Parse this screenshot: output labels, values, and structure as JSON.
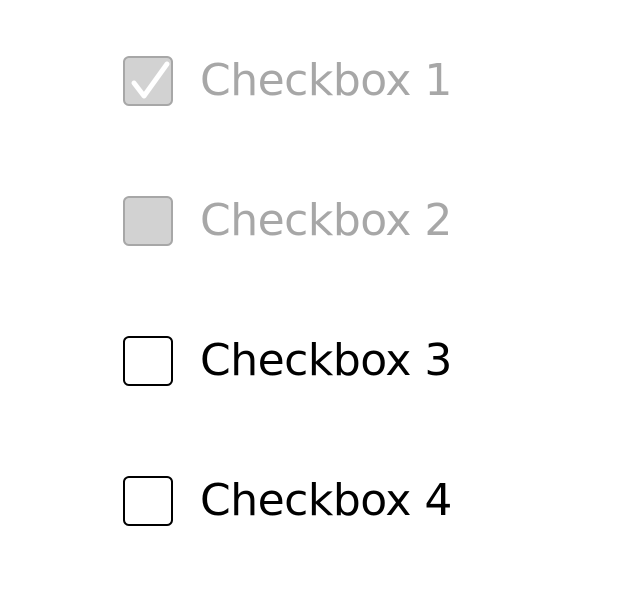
{
  "colors": {
    "disabled_text": "#a7a7a7",
    "disabled_fill": "#d2d2d2",
    "enabled_text": "#000000",
    "background": "#ffffff"
  },
  "checkboxes": [
    {
      "label": "Checkbox 1",
      "checked": true,
      "disabled": true,
      "check_icon": "check-icon"
    },
    {
      "label": "Checkbox 2",
      "checked": false,
      "disabled": true
    },
    {
      "label": "Checkbox 3",
      "checked": false,
      "disabled": false
    },
    {
      "label": "Checkbox 4",
      "checked": false,
      "disabled": false
    }
  ]
}
